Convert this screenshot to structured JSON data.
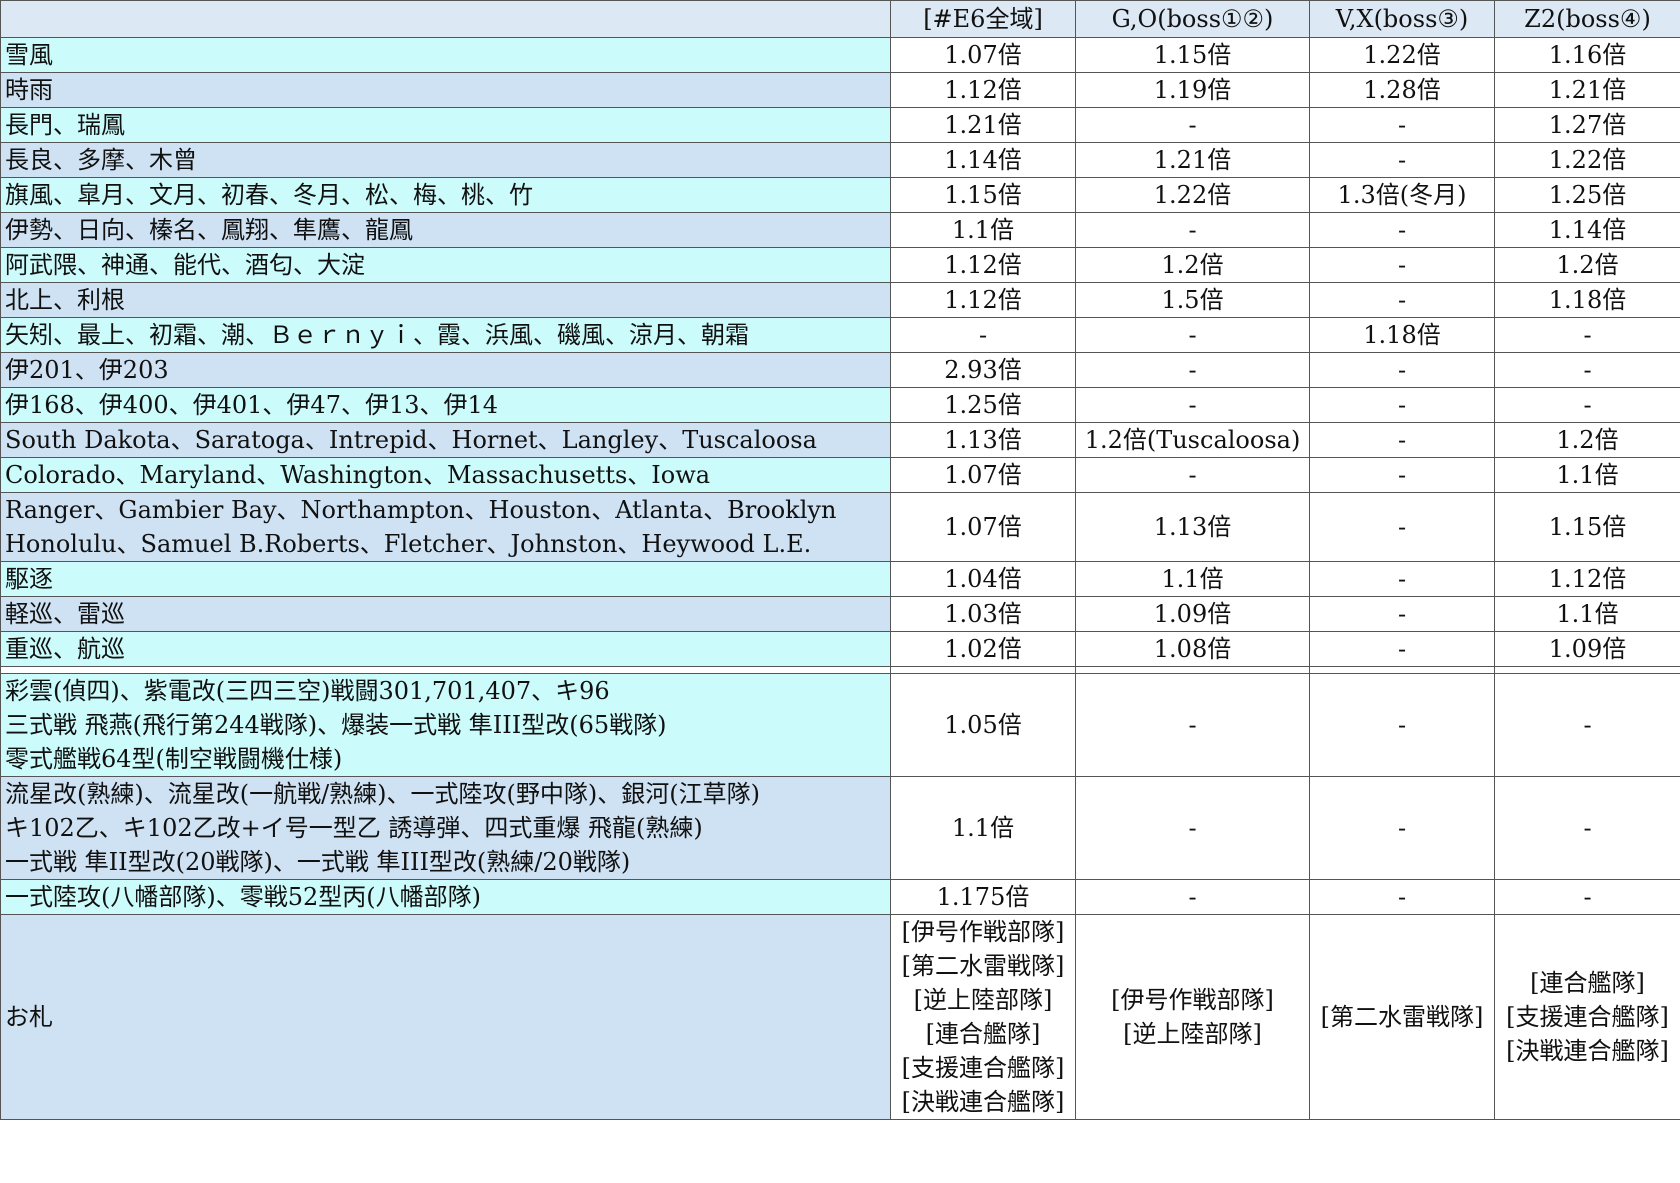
{
  "headers": [
    "",
    "[#E6全域]",
    "G,O(boss①②)",
    "V,X(boss③)",
    "Z2(boss④)"
  ],
  "rows": [
    {
      "lines": [
        "雪風"
      ],
      "cells": [
        "1.07倍",
        "1.15倍",
        "1.22倍",
        "1.16倍"
      ],
      "shade": "alt-cyan"
    },
    {
      "lines": [
        "時雨"
      ],
      "cells": [
        "1.12倍",
        "1.19倍",
        "1.28倍",
        "1.21倍"
      ],
      "shade": "alt-blue"
    },
    {
      "lines": [
        "長門、瑞鳳"
      ],
      "cells": [
        "1.21倍",
        "-",
        "-",
        "1.27倍"
      ],
      "shade": "alt-cyan"
    },
    {
      "lines": [
        "長良、多摩、木曾"
      ],
      "cells": [
        "1.14倍",
        "1.21倍",
        "-",
        "1.22倍"
      ],
      "shade": "alt-blue"
    },
    {
      "lines": [
        "旗風、皐月、文月、初春、冬月、松、梅、桃、竹"
      ],
      "cells": [
        "1.15倍",
        "1.22倍",
        "1.3倍(冬月)",
        "1.25倍"
      ],
      "shade": "alt-cyan"
    },
    {
      "lines": [
        "伊勢、日向、榛名、鳳翔、隼鷹、龍鳳"
      ],
      "cells": [
        "1.1倍",
        "-",
        "-",
        "1.14倍"
      ],
      "shade": "alt-blue"
    },
    {
      "lines": [
        "阿武隈、神通、能代、酒匂、大淀"
      ],
      "cells": [
        "1.12倍",
        "1.2倍",
        "-",
        "1.2倍"
      ],
      "shade": "alt-cyan"
    },
    {
      "lines": [
        "北上、利根"
      ],
      "cells": [
        "1.12倍",
        "1.5倍",
        "-",
        "1.18倍"
      ],
      "shade": "alt-blue"
    },
    {
      "lines": [
        "矢矧、最上、初霜、潮、Ｂｅｒｎｙｉ、霞、浜風、磯風、涼月、朝霜"
      ],
      "cells": [
        "-",
        "-",
        "1.18倍",
        "-"
      ],
      "shade": "alt-cyan"
    },
    {
      "lines": [
        "伊201、伊203"
      ],
      "cells": [
        "2.93倍",
        "-",
        "-",
        "-"
      ],
      "shade": "alt-blue"
    },
    {
      "lines": [
        "伊168、伊400、伊401、伊47、伊13、伊14"
      ],
      "cells": [
        "1.25倍",
        "-",
        "-",
        "-"
      ],
      "shade": "alt-cyan"
    },
    {
      "lines": [
        "South Dakota、Saratoga、Intrepid、Hornet、Langley、Tuscaloosa"
      ],
      "cells": [
        "1.13倍",
        "1.2倍(Tuscaloosa)",
        "-",
        "1.2倍"
      ],
      "shade": "alt-blue"
    },
    {
      "lines": [
        "Colorado、Maryland、Washington、Massachusetts、Iowa"
      ],
      "cells": [
        "1.07倍",
        "-",
        "-",
        "1.1倍"
      ],
      "shade": "alt-cyan"
    },
    {
      "lines": [
        "Ranger、Gambier Bay、Northampton、Houston、Atlanta、Brooklyn",
        "Honolulu、Samuel B.Roberts、Fletcher、Johnston、Heywood L.E."
      ],
      "cells": [
        "1.07倍",
        "1.13倍",
        "-",
        "1.15倍"
      ],
      "shade": "alt-blue"
    },
    {
      "lines": [
        "駆逐"
      ],
      "cells": [
        "1.04倍",
        "1.1倍",
        "-",
        "1.12倍"
      ],
      "shade": "alt-cyan"
    },
    {
      "lines": [
        "軽巡、雷巡"
      ],
      "cells": [
        "1.03倍",
        "1.09倍",
        "-",
        "1.1倍"
      ],
      "shade": "alt-blue"
    },
    {
      "lines": [
        "重巡、航巡"
      ],
      "cells": [
        "1.02倍",
        "1.08倍",
        "-",
        "1.09倍"
      ],
      "shade": "alt-cyan"
    },
    {
      "gap": true
    },
    {
      "lines": [
        "彩雲(偵四)、紫電改(三四三空)戦闘301,701,407、キ96",
        "三式戦 飛燕(飛行第244戦隊)、爆装一式戦 隼III型改(65戦隊)",
        "零式艦戦64型(制空戦闘機仕様)"
      ],
      "cells": [
        "1.05倍",
        "-",
        "-",
        "-"
      ],
      "shade": "alt-cyan"
    },
    {
      "lines": [
        "流星改(熟練)、流星改(一航戦/熟練)、一式陸攻(野中隊)、銀河(江草隊)",
        "キ102乙、キ102乙改+イ号一型乙 誘導弾、四式重爆 飛龍(熟練)",
        "一式戦 隼II型改(20戦隊)、一式戦 隼III型改(熟練/20戦隊)"
      ],
      "cells": [
        "1.1倍",
        "-",
        "-",
        "-"
      ],
      "shade": "alt-blue"
    },
    {
      "lines": [
        "一式陸攻(八幡部隊)、零戦52型丙(八幡部隊)"
      ],
      "cells": [
        "1.175倍",
        "-",
        "-",
        "-"
      ],
      "shade": "alt-cyan"
    }
  ],
  "tags_row": {
    "label": "お札",
    "cells": [
      [
        "[伊号作戦部隊]",
        "[第二水雷戦隊]",
        "[逆上陸部隊]",
        "[連合艦隊]",
        "[支援連合艦隊]",
        "[決戦連合艦隊]"
      ],
      [
        "[伊号作戦部隊]",
        "[逆上陸部隊]"
      ],
      [
        "[第二水雷戦隊]"
      ],
      [
        "[連合艦隊]",
        "[支援連合艦隊]",
        "[決戦連合艦隊]"
      ]
    ]
  }
}
